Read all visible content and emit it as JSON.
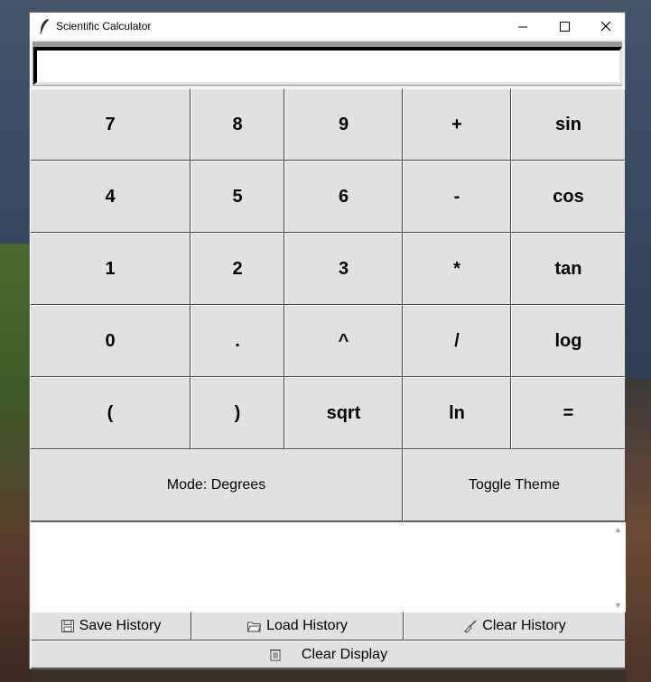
{
  "window": {
    "title": "Scientific Calculator"
  },
  "display": {
    "value": ""
  },
  "keys": {
    "row1": [
      "7",
      "8",
      "9",
      "+",
      "sin"
    ],
    "row2": [
      "4",
      "5",
      "6",
      "-",
      "cos"
    ],
    "row3": [
      "1",
      "2",
      "3",
      "*",
      "tan"
    ],
    "row4": [
      "0",
      ".",
      "^",
      "/",
      "log"
    ],
    "row5": [
      "(",
      ")",
      "sqrt",
      "ln",
      "="
    ]
  },
  "mode_button": "Mode: Degrees",
  "theme_button": "Toggle Theme",
  "history": {
    "text": ""
  },
  "history_buttons": {
    "save": "Save History",
    "load": "Load History",
    "clear": "Clear History"
  },
  "clear_display": "Clear Display",
  "icons": {
    "app": "feather-icon",
    "save": "floppy-disk-icon",
    "load": "folder-icon",
    "clear_history": "broom-icon",
    "clear_display": "trash-icon"
  }
}
